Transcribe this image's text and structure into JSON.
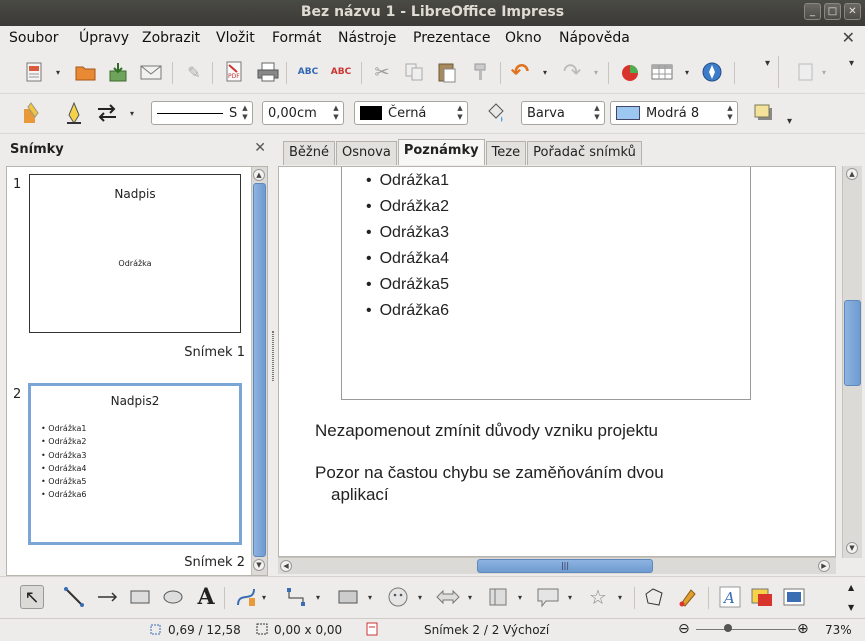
{
  "window": {
    "title": "Bez názvu 1 - LibreOffice Impress",
    "buttons": [
      "_",
      "□",
      "✕"
    ]
  },
  "menu": {
    "items": [
      "Soubor",
      "Úpravy",
      "Zobrazit",
      "Vložit",
      "Formát",
      "Nástroje",
      "Prezentace",
      "Okno",
      "Nápověda"
    ],
    "close": "✕"
  },
  "toolbar2": {
    "line_style": "S",
    "line_width": "0,00cm",
    "line_color": "Černá",
    "fill_type": "Barva",
    "fill_color": "Modrá 8"
  },
  "colors": {
    "line_color_swatch": "#000000",
    "fill_color_swatch": "#9cc7f0",
    "selection": "#7ba5d5"
  },
  "slides_panel": {
    "title": "Snímky",
    "close": "✕",
    "slides": [
      {
        "number": "1",
        "title": "Nadpis",
        "body": "Odrážka",
        "label": "Snímek 1"
      },
      {
        "number": "2",
        "title": "Nadpis2",
        "bullets": [
          "Odrážka1",
          "Odrážka2",
          "Odrážka3",
          "Odrážka4",
          "Odrážka5",
          "Odrážka6"
        ],
        "label": "Snímek 2"
      }
    ]
  },
  "tabs": [
    {
      "label": "Běžné"
    },
    {
      "label": "Osnova"
    },
    {
      "label": "Poznámky",
      "active": true
    },
    {
      "label": "Teze"
    },
    {
      "label": "Pořadač snímků"
    }
  ],
  "notes_view": {
    "bullets": [
      "Odrážka1",
      "Odrážka2",
      "Odrážka3",
      "Odrážka4",
      "Odrážka5",
      "Odrážka6"
    ],
    "notes": [
      "Nezapomenout zmínit důvody vzniku projektu",
      "Pozor na častou chybu se zaměňováním dvou",
      "aplikací"
    ]
  },
  "statusbar": {
    "position": "0,69 / 12,58",
    "size": "0,00 x 0,00",
    "slide": "Snímek 2 / 2",
    "layout": "Výchozí",
    "zoom": "73%",
    "zoom_minus": "⊖",
    "zoom_plus": "⊕"
  },
  "icons": {
    "doc_props": "✎",
    "abc": "ABC",
    "scissors": "✂",
    "undo": "↶",
    "redo": "↷",
    "chevron": "▾",
    "pointer": "↖",
    "text": "A",
    "star": "☆"
  }
}
